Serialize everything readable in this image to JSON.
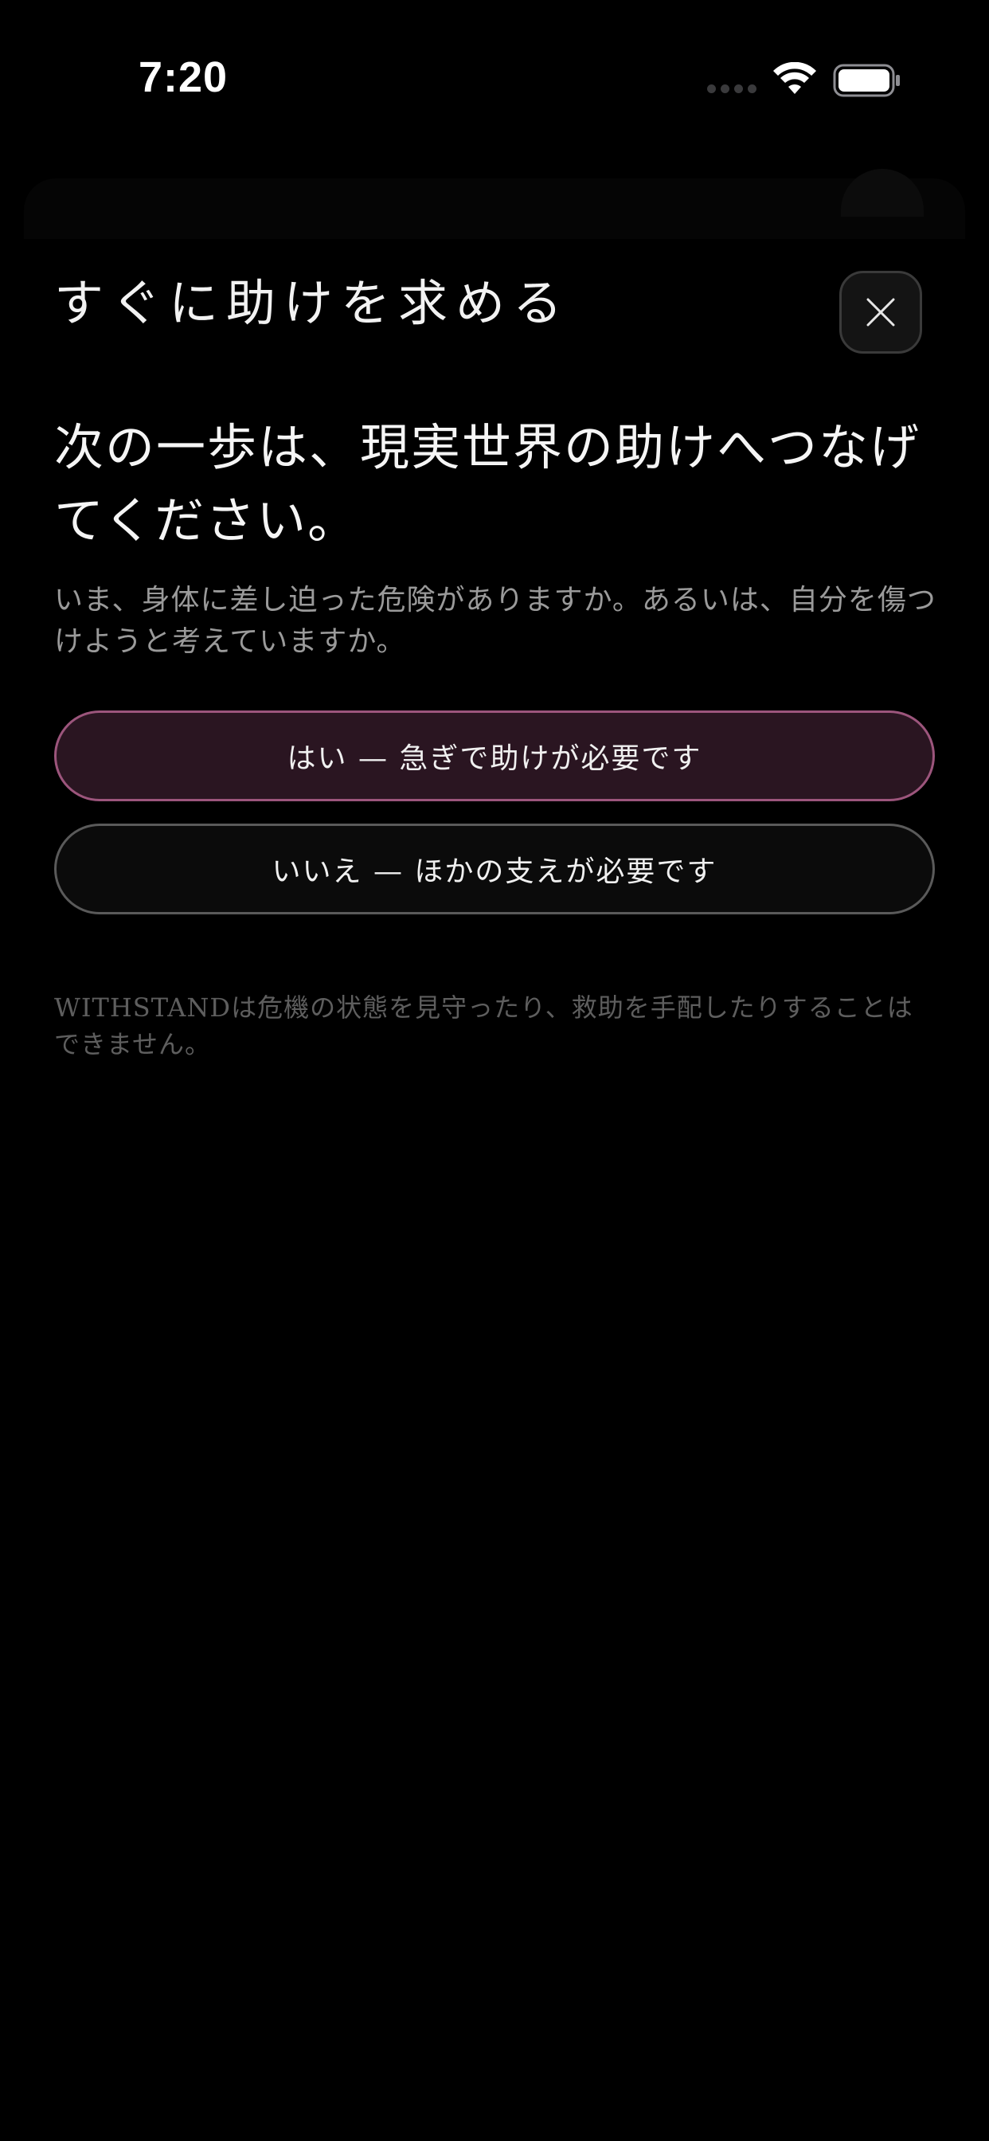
{
  "status_bar": {
    "time": "7:20",
    "icons": [
      "signal-dots-icon",
      "wifi-icon",
      "battery-icon"
    ]
  },
  "modal": {
    "title": "すぐに助けを求める",
    "close_icon": "close-icon",
    "headline": "次の一歩は、現実世界の助けへつなげてください。",
    "body": "いま、身体に差し迫った危険がありますか。あるいは、自分を傷つけようと考えていますか。",
    "yes_button_label": "はい — 急ぎで助けが必要です",
    "no_button_label": "いいえ — ほかの支えが必要です",
    "disclaimer": "WITHSTANDは危機の状態を見守ったり、救助を手配したりすることはできません。"
  },
  "colors": {
    "background": "#000000",
    "yes_button_fill": "#2a1521",
    "yes_button_border": "#9c557c",
    "no_button_border": "#5a5a5a",
    "body_text": "#9a9a9a",
    "disclaimer_text": "#5e5e5e"
  }
}
